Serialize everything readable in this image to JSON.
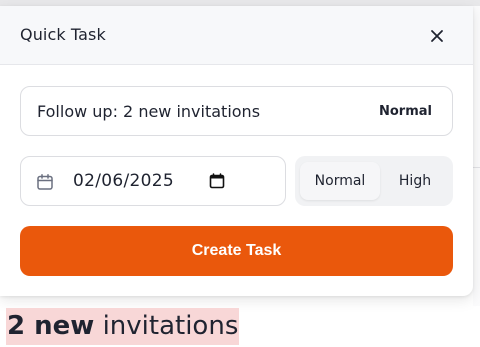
{
  "modal": {
    "title": "Quick Task",
    "close_icon": "close-icon",
    "task_input": {
      "value": "Follow up: 2 new invitations",
      "priority_tag": "Normal"
    },
    "date_field": {
      "value": "02/06/2025",
      "left_icon": "calendar-icon",
      "picker_icon": "calendar-picker-icon"
    },
    "priority_options": {
      "selected": "Normal",
      "normal": "Normal",
      "high": "High"
    },
    "create_button": "Create Task"
  },
  "background_snippet": {
    "bold": "2 new",
    "regular": " invitations",
    "highlight_color": "#f8d7d7"
  },
  "colors": {
    "accent": "#ea580c",
    "text": "#1f2330",
    "header_bg": "#f7f8fa"
  }
}
